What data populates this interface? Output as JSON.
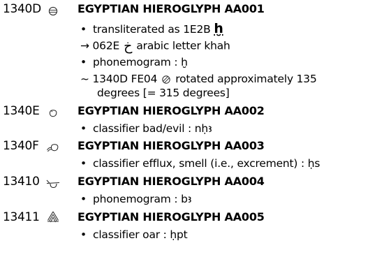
{
  "entries": [
    {
      "code": "1340D",
      "icon": "hieroglyph-aa001-icon",
      "name": "EGYPTIAN HIEROGLYPH AA001",
      "transliterated_prefix": "transliterated as 1E2B",
      "transliterated_char": "ḫ",
      "crossref_code": "→ 062E",
      "crossref_char": "خ",
      "crossref_label": "arabic letter khah",
      "phonemogram": "phonemogram : ḫ",
      "variant_prefix": "~ 1340D FE04",
      "variant_text_1": "rotated approximately 135",
      "variant_text_2": "degrees [= 315 degrees]"
    },
    {
      "code": "1340E",
      "icon": "hieroglyph-aa002-icon",
      "name": "EGYPTIAN HIEROGLYPH AA002",
      "note": "classifier bad/evil : nḥꜣ"
    },
    {
      "code": "1340F",
      "icon": "hieroglyph-aa003-icon",
      "name": "EGYPTIAN HIEROGLYPH AA003",
      "note": "classifier efflux, smell (i.e., excrement) : ḥs"
    },
    {
      "code": "13410",
      "icon": "hieroglyph-aa004-icon",
      "name": "EGYPTIAN HIEROGLYPH AA004",
      "note": "phonemogram : bꜣ"
    },
    {
      "code": "13411",
      "icon": "hieroglyph-aa005-icon",
      "name": "EGYPTIAN HIEROGLYPH AA005",
      "note": "classifier oar : ḥpt"
    }
  ],
  "bullet": "•"
}
